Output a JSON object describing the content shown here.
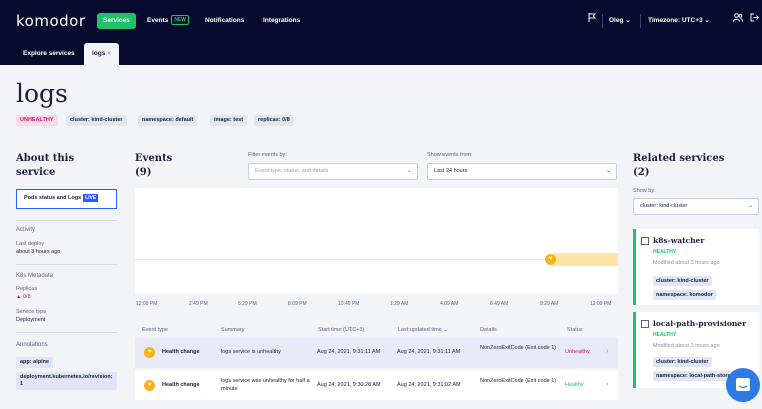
{
  "colors": {
    "nav_bg": "#070b2e",
    "accent_green": "#1ec26b",
    "accent_blue": "#2b5cff",
    "unhealthy": "#d01a6a",
    "event_marker": "#f7b21a"
  },
  "topbar": {
    "logo": "komodor",
    "nav": [
      {
        "label": "Services",
        "active": true
      },
      {
        "label": "Events",
        "badge": "NEW"
      },
      {
        "label": "Notifications"
      },
      {
        "label": "Integrations"
      }
    ],
    "flag_icon": "flag-icon",
    "user": "Oleg",
    "timezone": "Timezone: UTC+3",
    "users_icon": "users-icon",
    "logout_icon": "logout-icon"
  },
  "tabs": [
    {
      "label": "Explore services"
    },
    {
      "label": "logs",
      "close": "×",
      "active": true
    }
  ],
  "service": {
    "title": "logs",
    "chips": [
      "UNHEALTHY",
      "cluster: kind-cluster",
      "namespace: default",
      "image: test",
      "replicas: 0/8"
    ]
  },
  "about": {
    "heading": "About this service",
    "pods_button": "Pods status and Logs",
    "live_badge": "LIVE",
    "activity_label": "Activity",
    "last_deploy_label": "Last deploy",
    "last_deploy_value": "about 3 hours ago",
    "k8s_label": "K8s Metadata",
    "replicas_label": "Replicas",
    "replicas_value": "0/8",
    "service_type_label": "Service type",
    "service_type_value": "Deployment",
    "annotations_label": "Annotations",
    "annotations": [
      "app: alpine",
      "deployment.kubernetes.io/revision: 1"
    ]
  },
  "events": {
    "heading": "Events",
    "count": "(9)",
    "filter_label": "Filter events by:",
    "filter_placeholder": "Event type, status, and details",
    "show_label": "Show events from:",
    "show_value": "Last 24 hours",
    "timeline_ticks": [
      "12:09 PM",
      "2:49 PM",
      "5:29 PM",
      "8:09 PM",
      "10:49 PM",
      "1:29 AM",
      "4:09 AM",
      "6:49 AM",
      "9:29 AM",
      "12:09 PM"
    ],
    "columns": [
      "Event type",
      "Summary",
      "Start time (UTC+3)",
      "Last updated time",
      "Details",
      "Status"
    ],
    "rows": [
      {
        "type": "Health change",
        "summary": "logs service is unhealthy",
        "start": "Aug 24, 2021, 9:31:11 AM",
        "updated": "Aug 24, 2021, 9:31:11 AM",
        "details": "NonZeroExitCode (Exit code 1)",
        "status": "Unhealthy"
      },
      {
        "type": "Health change",
        "summary": "logs service was unhealthy for half a minute",
        "start": "Aug 24, 2021, 9:30:28 AM",
        "updated": "Aug 24, 2021, 9:31:02 AM",
        "details": "NonZeroExitCode (Exit code 1)",
        "status": "Healthy"
      }
    ]
  },
  "related": {
    "heading": "Related services",
    "count": "(2)",
    "show_by_label": "Show by:",
    "show_by_value": "cluster: kind-cluster",
    "cards": [
      {
        "name": "k8s-watcher",
        "status": "HEALTHY",
        "modified": "Modified about 3 hours ago",
        "chips": [
          "cluster: kind-cluster",
          "namespace: komodor"
        ]
      },
      {
        "name": "local-path-provisioner",
        "status": "HEALTHY",
        "modified": "Modified about 3 hours ago",
        "chips": [
          "cluster: kind-cluster",
          "namespace: local-path-storage"
        ]
      }
    ]
  }
}
